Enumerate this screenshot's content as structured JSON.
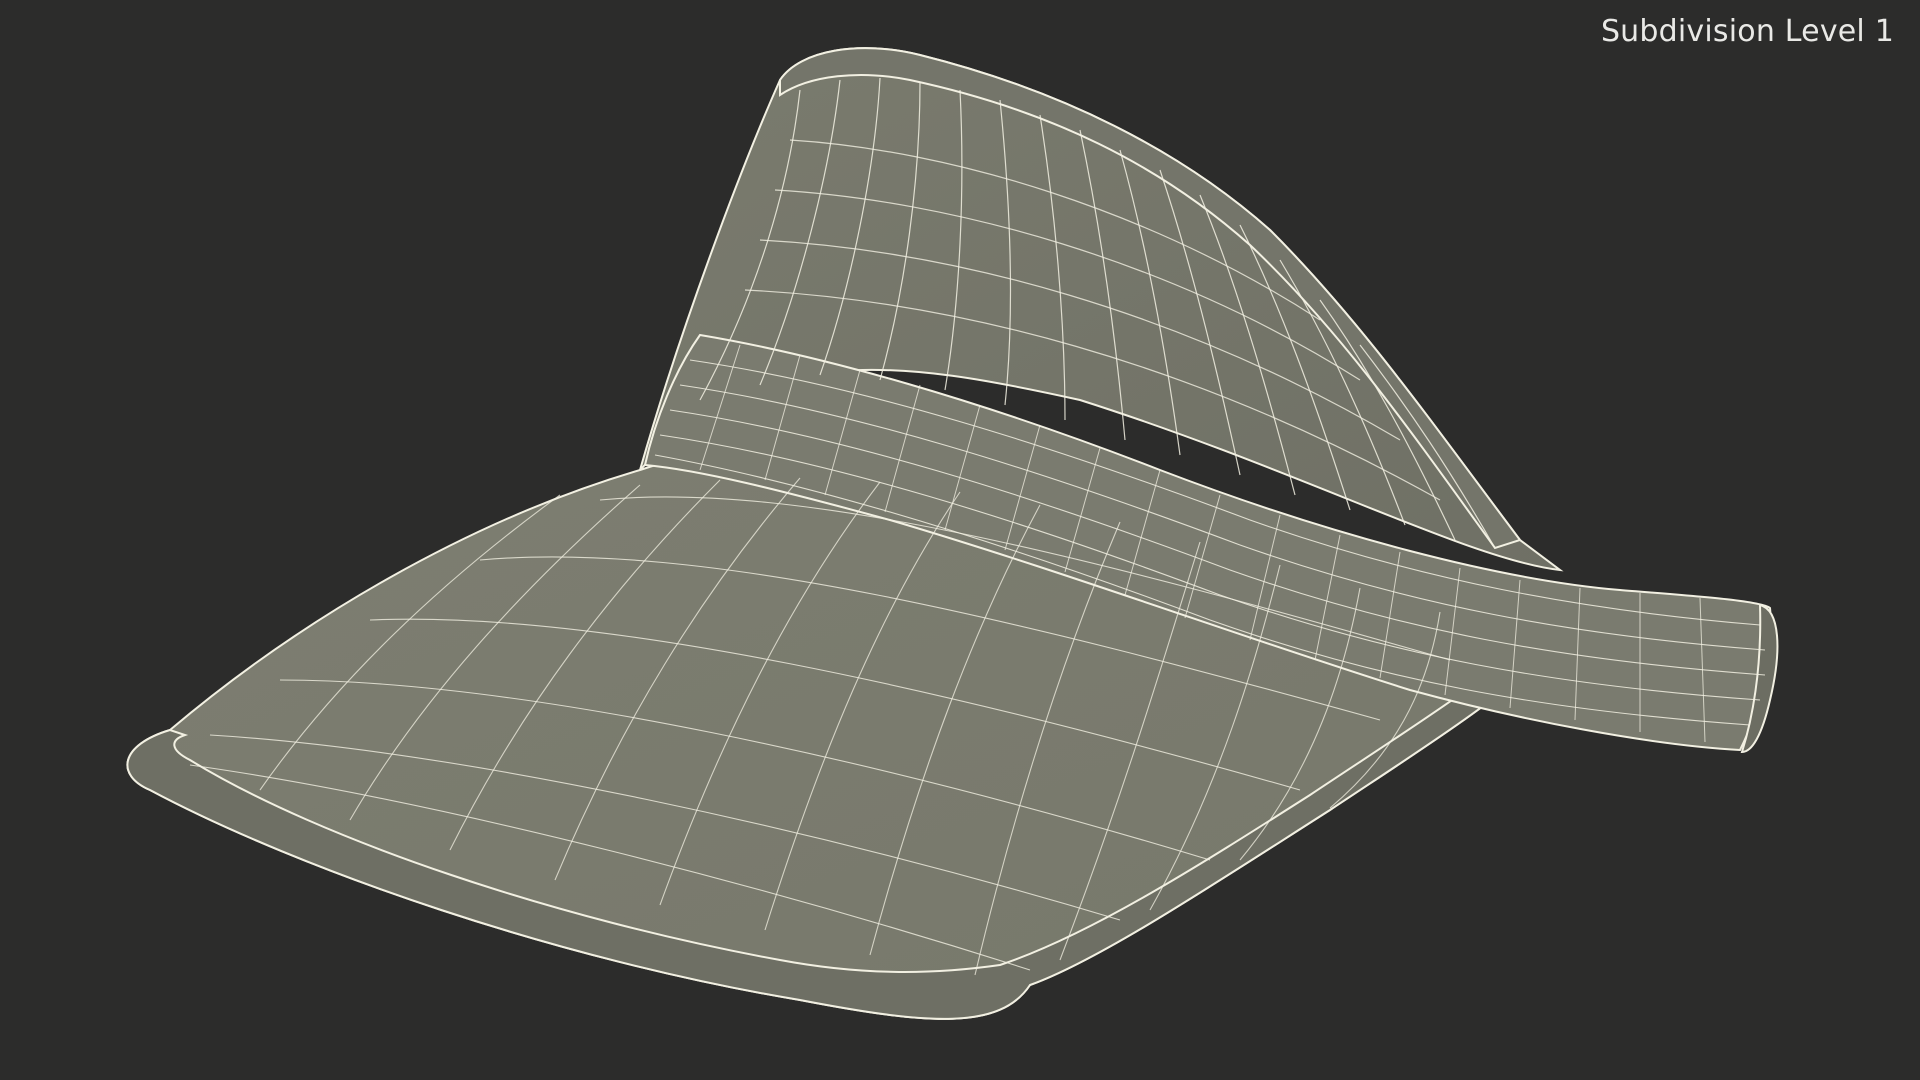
{
  "viewport": {
    "caption": "Subdivision Level 1",
    "background_color": "#2c2c2b",
    "surface_color": "#7b7c6f",
    "wire_color": "#f2f0e2",
    "caption_color": "#e9e9e6"
  },
  "model": {
    "subject": "sun-visor-wireframe-icon"
  }
}
